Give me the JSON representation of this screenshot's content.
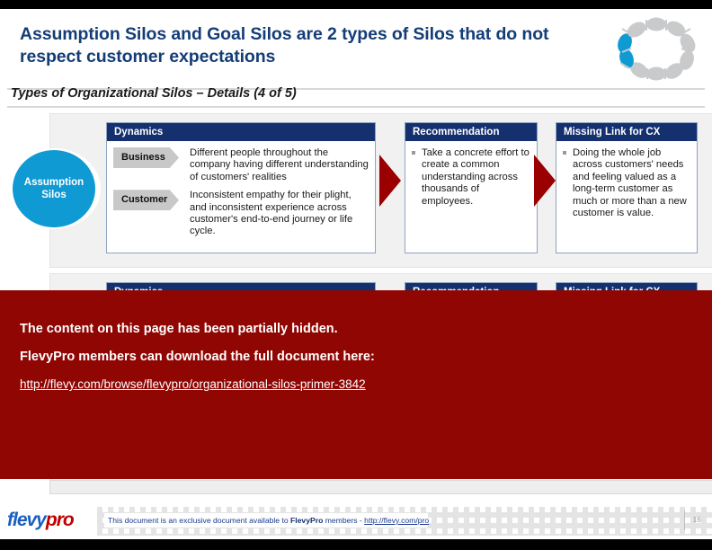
{
  "header": {
    "title": "Assumption Silos and Goal Silos are 2 types of Silos that do not respect customer expectations",
    "logo_name": "flevy-ring-logo",
    "logo_colors": {
      "grey": "#c9cacb",
      "blue": "#0f9ad4"
    }
  },
  "subtitle": "Types of Organizational Silos – Details (4 of 5)",
  "silo": {
    "label": "Assumption Silos",
    "color": "#0f9ad4"
  },
  "columns": {
    "dynamics": "Dynamics",
    "recommendation": "Recommendation",
    "missing_link": "Missing Link for CX"
  },
  "row1": {
    "dynamics": [
      {
        "tag": "Business",
        "text": "Different people throughout the company having different understanding of customers' realities"
      },
      {
        "tag": "Customer",
        "text": "Inconsistent empathy for their plight, and inconsistent experience across customer's end-to-end journey or life cycle."
      }
    ],
    "recommendation": [
      "Take a concrete effort to create a common understanding across thousands of employees."
    ],
    "missing_link": [
      "Doing the whole job across customers' needs and feeling valued as a long-term customer as much or more than a new customer is value."
    ]
  },
  "row2": {
    "dynamics": "Dynamics",
    "recommendation": "Recommendation",
    "missing_link": "Missing Link for CX"
  },
  "overlay": {
    "line1": "The content on this page has been partially hidden.",
    "line2": "FlevyPro members can download the full document here:",
    "link": "http://flevy.com/browse/flevypro/organizational-silos-primer-3842",
    "color": "#8f0603"
  },
  "footer": {
    "logo_part1": "flevy",
    "logo_part2": "pro",
    "text_before": "This document is an exclusive document available to ",
    "text_brand": "FlevyPro",
    "text_after": " members - ",
    "link": "http://flevy.com/pro",
    "page": "16"
  },
  "arrows": {
    "color": "#9a0000",
    "name": "chevron-right-arrow"
  }
}
